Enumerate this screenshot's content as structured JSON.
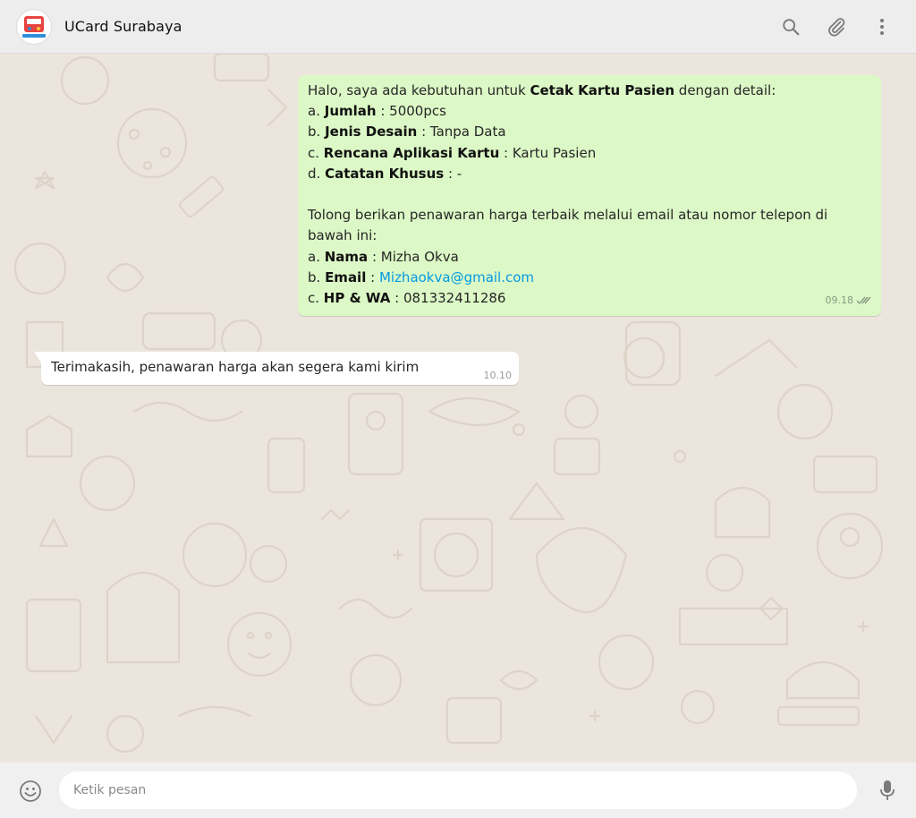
{
  "header": {
    "contact_name": "UCard Surabaya",
    "avatar_icon": "ucard-logo-icon",
    "search_icon": "search-icon",
    "attach_icon": "paperclip-icon",
    "menu_icon": "kebab-menu-icon"
  },
  "messages": {
    "outgoing": {
      "intro_prefix": "Halo, saya ada kebutuhan untuk ",
      "intro_bold": "Cetak Kartu Pasien",
      "intro_suffix": " dengan detail:",
      "items": [
        {
          "prefix": "a. ",
          "label": "Jumlah",
          "value": " : 5000pcs"
        },
        {
          "prefix": "b. ",
          "label": "Jenis Desain",
          "value": " : Tanpa Data"
        },
        {
          "prefix": "c. ",
          "label": "Rencana Aplikasi Kartu",
          "value": " : Kartu Pasien"
        },
        {
          "prefix": "d. ",
          "label": "Catatan Khusus",
          "value": " : -"
        }
      ],
      "request_line1": "Tolong berikan penawaran harga terbaik melalui email atau nomor telepon di",
      "request_line2": "bawah ini:",
      "contact": [
        {
          "prefix": "a. ",
          "label": "Nama",
          "value": " : Mizha Okva"
        },
        {
          "prefix": "b. ",
          "label": "Email",
          "sep": " : ",
          "link": "Mizhaokva@gmail.com"
        },
        {
          "prefix": "c. ",
          "label": "HP & WA",
          "value": " : 081332411286"
        }
      ],
      "time": "09.18",
      "status_icon": "double-check-icon"
    },
    "incoming": {
      "text": "Terimakasih, penawaran harga akan segera kami kirim",
      "time": "10.10"
    }
  },
  "footer": {
    "emoji_icon": "emoji-icon",
    "input_placeholder": "Ketik pesan",
    "input_value": "",
    "mic_icon": "microphone-icon"
  },
  "colors": {
    "header_bg": "#ededed",
    "chat_bg": "#ece5dd",
    "outgoing_bubble": "#dcf8c6",
    "incoming_bubble": "#ffffff",
    "link": "#039be5"
  }
}
